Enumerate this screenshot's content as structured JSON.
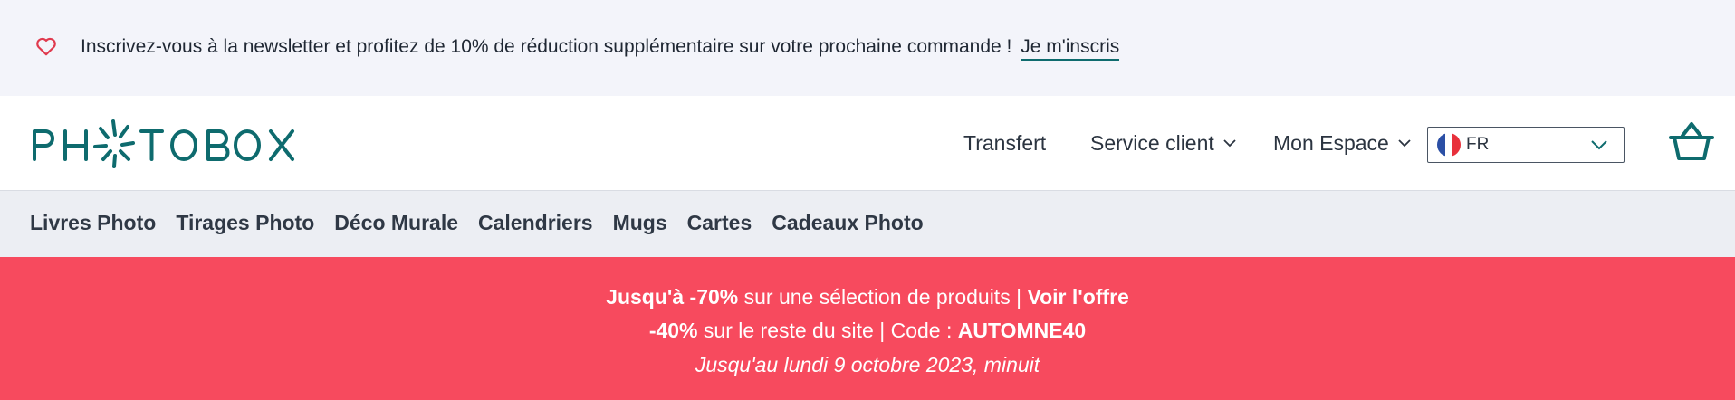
{
  "topbar": {
    "text": "Inscrivez-vous à la newsletter et profitez de 10% de réduction supplémentaire sur votre prochaine commande !",
    "link": "Je m'inscris",
    "icon": "heart-icon"
  },
  "header": {
    "logo": "PHOTOBOX",
    "transfer": "Transfert",
    "service": "Service client",
    "account": "Mon Espace",
    "language": {
      "code": "FR",
      "flag_colors": [
        "#2b4fa5",
        "#ffffff",
        "#e8313c"
      ]
    },
    "basket_icon": "basket-icon"
  },
  "categories": [
    "Livres Photo",
    "Tirages Photo",
    "Déco Murale",
    "Calendriers",
    "Mugs",
    "Cartes",
    "Cadeaux Photo"
  ],
  "sale": {
    "line1_bold": "Jusqu'à -70%",
    "line1_text": "sur une sélection de produits |",
    "line1_link": "Voir l'offre",
    "line2_bold": "-40%",
    "line2_text": "sur le reste du site | Code :",
    "line2_code": "AUTOMNE40",
    "line3": "Jusqu'au lundi 9 octobre 2023, minuit"
  },
  "colors": {
    "brand": "#0e6b6e",
    "sale": "#f74a5e",
    "heart": "#e03a4e"
  }
}
